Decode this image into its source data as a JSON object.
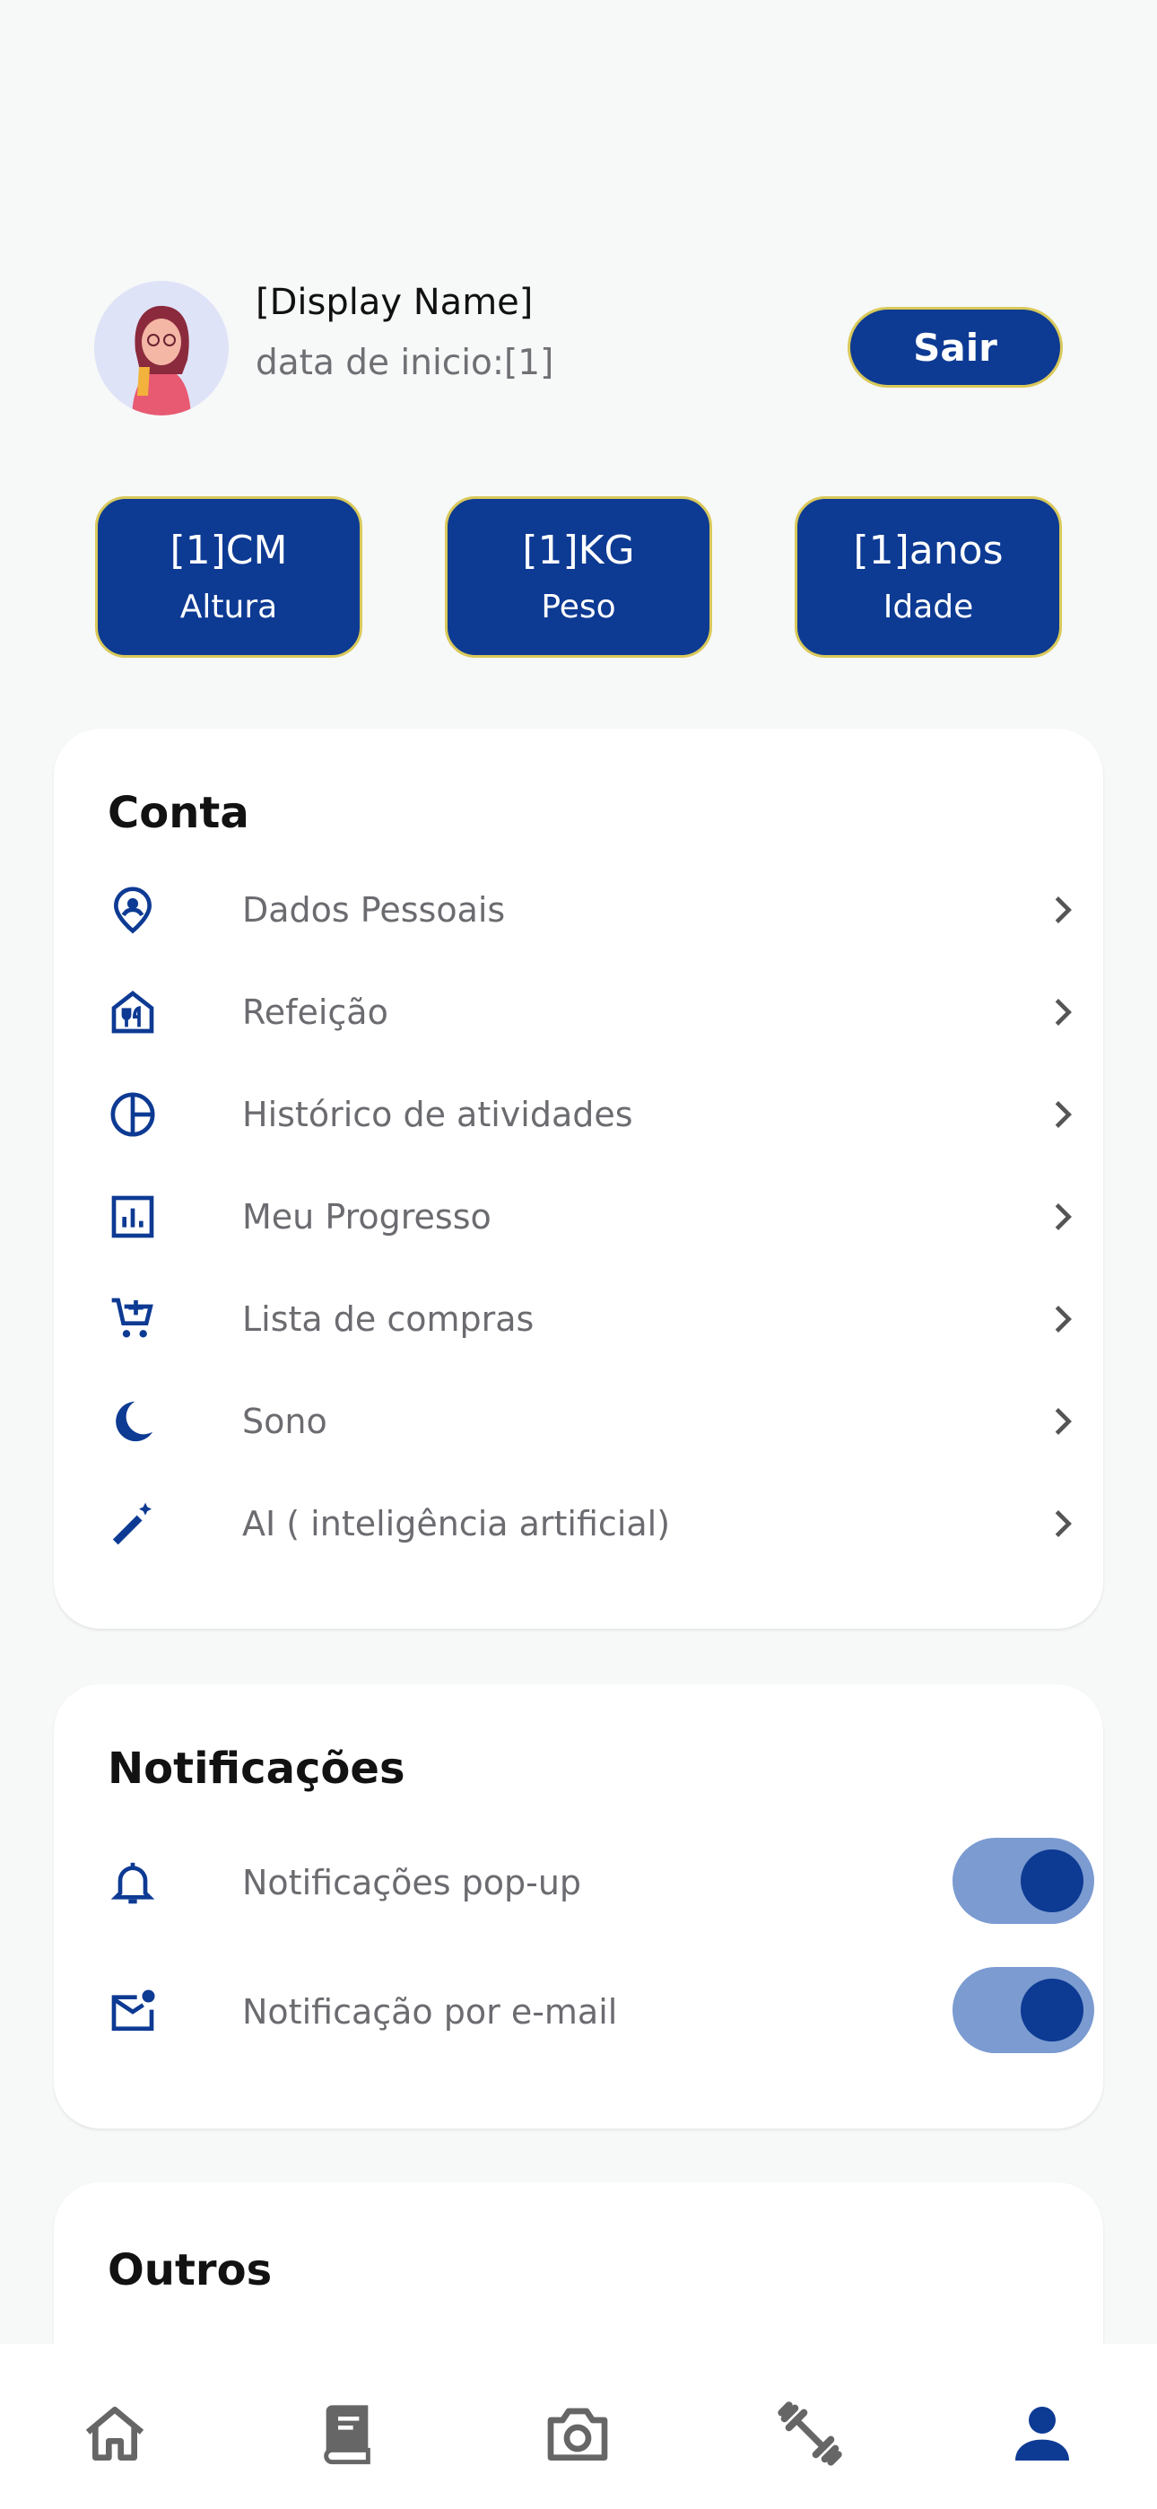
{
  "profile": {
    "display_name": "[Display Name]",
    "start_date": "data de inicio:[1]",
    "logout_label": "Sair"
  },
  "stats": [
    {
      "value": "[1]CM",
      "label": "Altura"
    },
    {
      "value": "[1]KG",
      "label": "Peso"
    },
    {
      "value": "[1]anos",
      "label": "Idade"
    }
  ],
  "account": {
    "title": "Conta",
    "items": [
      {
        "label": "Dados Pessoais",
        "icon": "location-person-icon"
      },
      {
        "label": "Refeição",
        "icon": "restaurant-icon"
      },
      {
        "label": "Histórico de atividades",
        "icon": "pie-chart-icon"
      },
      {
        "label": "Meu Progresso",
        "icon": "bar-chart-icon"
      },
      {
        "label": "Lista de compras",
        "icon": "cart-add-icon"
      },
      {
        "label": "Sono",
        "icon": "moon-icon"
      },
      {
        "label": "AI ( inteligência artificial)",
        "icon": "magic-wand-icon"
      }
    ]
  },
  "notifications": {
    "title": "Notificações",
    "items": [
      {
        "label": "Notificações pop-up",
        "icon": "bell-icon",
        "enabled": true
      },
      {
        "label": "Notificação por e-mail",
        "icon": "mail-badge-icon",
        "enabled": true
      }
    ]
  },
  "others": {
    "title": "Outros"
  },
  "nav": {
    "items": [
      "home-icon",
      "book-icon",
      "camera-icon",
      "dumbbell-icon",
      "person-icon"
    ],
    "active": "person-icon"
  },
  "colors": {
    "primary": "#0d3a93",
    "accent_border": "#d9c95a",
    "toggle_track": "#7b9bd1",
    "background": "#f7f8f8"
  }
}
